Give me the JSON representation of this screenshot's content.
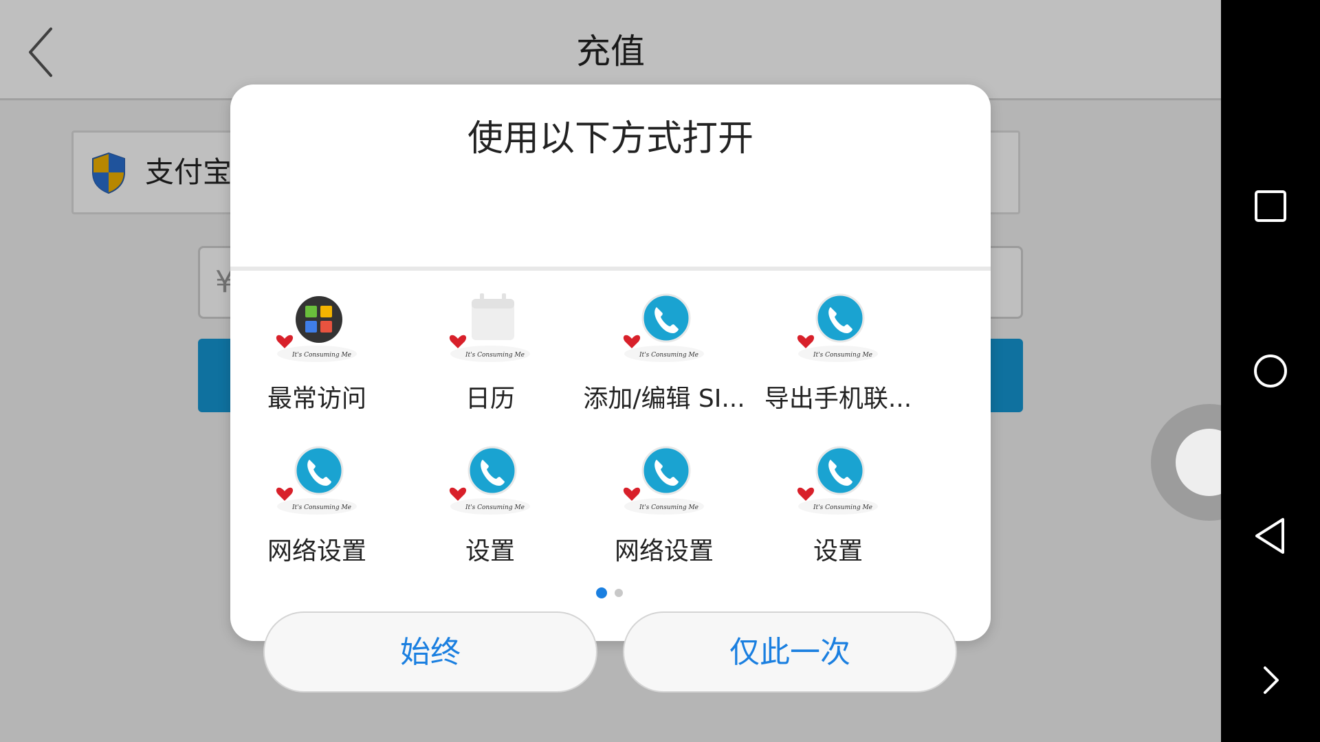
{
  "page": {
    "title": "充值",
    "back_icon": "chevron-left-icon"
  },
  "payment": {
    "method_label": "支付宝",
    "method_icon": "shield-icon",
    "amount_placeholder": "¥"
  },
  "dialog": {
    "title": "使用以下方式打开",
    "apps": [
      {
        "label": "最常访问",
        "icon": "frequent-visits-icon"
      },
      {
        "label": "日历",
        "icon": "calendar-icon"
      },
      {
        "label": "添加/编辑 SI...",
        "icon": "phone-icon"
      },
      {
        "label": "导出手机联...",
        "icon": "phone-icon"
      },
      {
        "label": "网络设置",
        "icon": "phone-icon"
      },
      {
        "label": "设置",
        "icon": "phone-icon"
      },
      {
        "label": "网络设置",
        "icon": "phone-icon"
      },
      {
        "label": "设置",
        "icon": "phone-icon"
      }
    ],
    "icon_caption": "It's Consuming Me",
    "page_count": 2,
    "current_page": 1,
    "buttons": {
      "always": "始终",
      "just_once": "仅此一次"
    }
  },
  "colors": {
    "accent": "#1a7fe0",
    "recharge_button": "#1497d4",
    "phone_icon": "#1aa3d1"
  }
}
